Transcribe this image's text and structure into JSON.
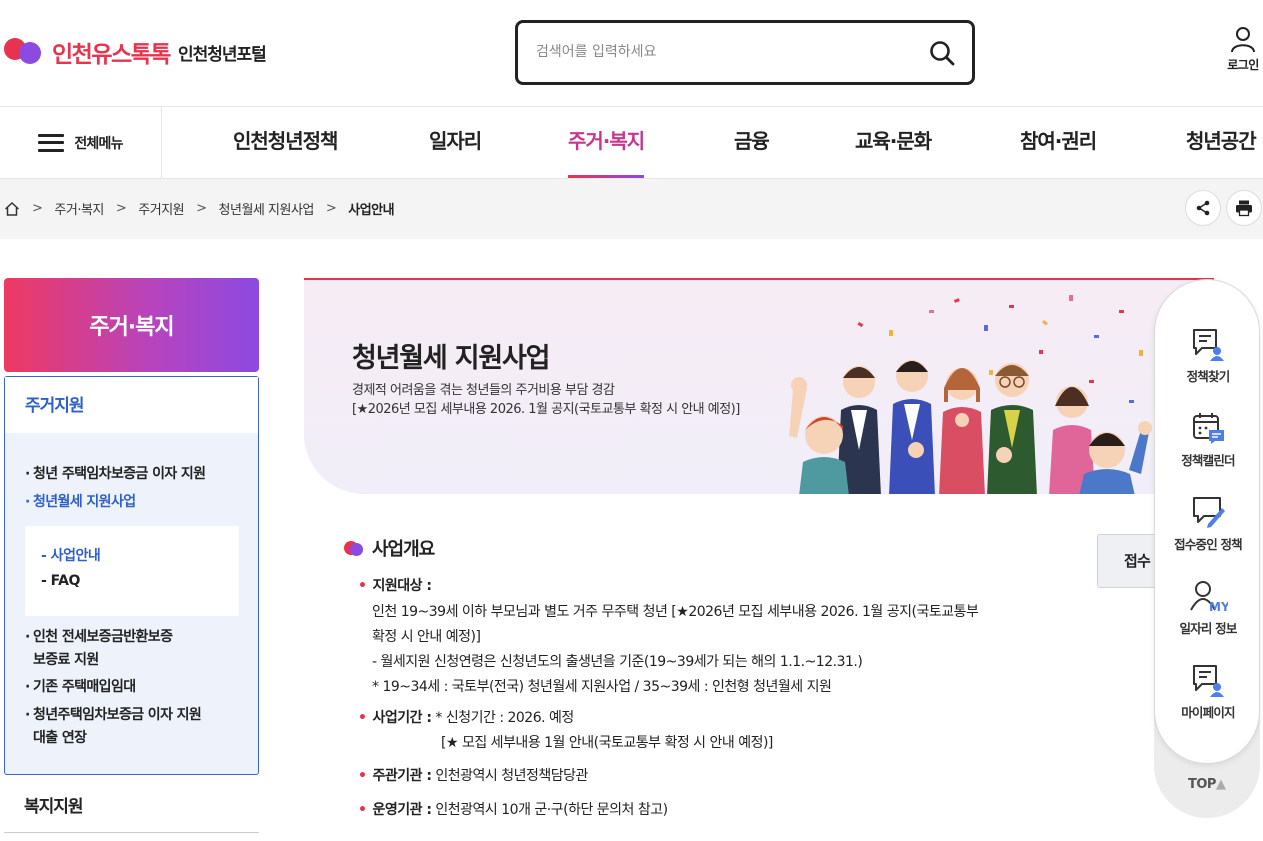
{
  "header": {
    "logo_name": "인천유스톡톡",
    "logo_sub": "인천청년포털",
    "search_placeholder": "검색어를 입력하세요",
    "login_label": "로그인"
  },
  "nav": {
    "all_menu_label": "전체메뉴",
    "items": [
      "인천청년정책",
      "일자리",
      "주거·복지",
      "금융",
      "교육·문화",
      "참여·권리",
      "청년공간"
    ],
    "active": "주거·복지"
  },
  "breadcrumb": [
    "주거·복지",
    "주거지원",
    "청년월세 지원사업",
    "사업안내"
  ],
  "sidebar": {
    "heading": "주거·복지",
    "group_title": "주거지원",
    "items": [
      "청년 주택임차보증금 이자 지원",
      "청년월세 지원사업",
      "인천 전세보증금반환보증",
      "보증료 지원",
      "기존 주택매입임대",
      "청년주택임차보증금 이자 지원",
      "대출 연장"
    ],
    "sub_items": [
      "- 사업안내",
      "- FAQ"
    ],
    "next_group_title": "복지지원"
  },
  "banner": {
    "title": "청년월세 지원사업",
    "desc_line1": "경제적 어려움을 겪는 청년들의 주거비용 부담 경감",
    "desc_line2": "[★2026년 모집 세부내용 2026. 1월 공지(국토교통부 확정 시 안내 예정)]"
  },
  "content": {
    "section_title": "사업개요",
    "apply_label": "접수",
    "target_label": "지원대상 :",
    "target_lines": [
      "인천 19~39세 이하 부모님과 별도 거주 무주택 청년 [★2026년 모집 세부내용 2026. 1월 공지(국토교통부",
      "확정 시 안내 예정)]",
      "- 월세지원 신청연령은 신청년도의 출생년을 기준(19~39세가 되는 해의 1.1.~12.31.)",
      "* 19~34세 : 국토부(전국) 청년월세 지원사업 / 35~39세 : 인천형 청년월세 지원"
    ],
    "period_label": "사업기간 :",
    "period_line1": "* 신청기간 : 2026. 예정",
    "period_line2": "[★ 모집 세부내용 1월 안내(국토교통부 확정 시 안내 예정)]",
    "org_label": "주관기관 :",
    "org_value": "인천광역시 청년정책담당관",
    "ops_label": "운영기관 :",
    "ops_value": "인천광역시 10개 군·구(하단 문의처 참고)"
  },
  "quick_panel": {
    "items": [
      "정책찾기",
      "정책캘린더",
      "접수중인 정책",
      "일자리 정보",
      "마이페이지"
    ],
    "top_label": "TOP",
    "my_badge": "MY"
  },
  "colors": {
    "brand_red": "#e8334f",
    "brand_purple": "#8b4ae0",
    "active_nav": "#c6368f",
    "link_blue": "#2f5fc9"
  }
}
